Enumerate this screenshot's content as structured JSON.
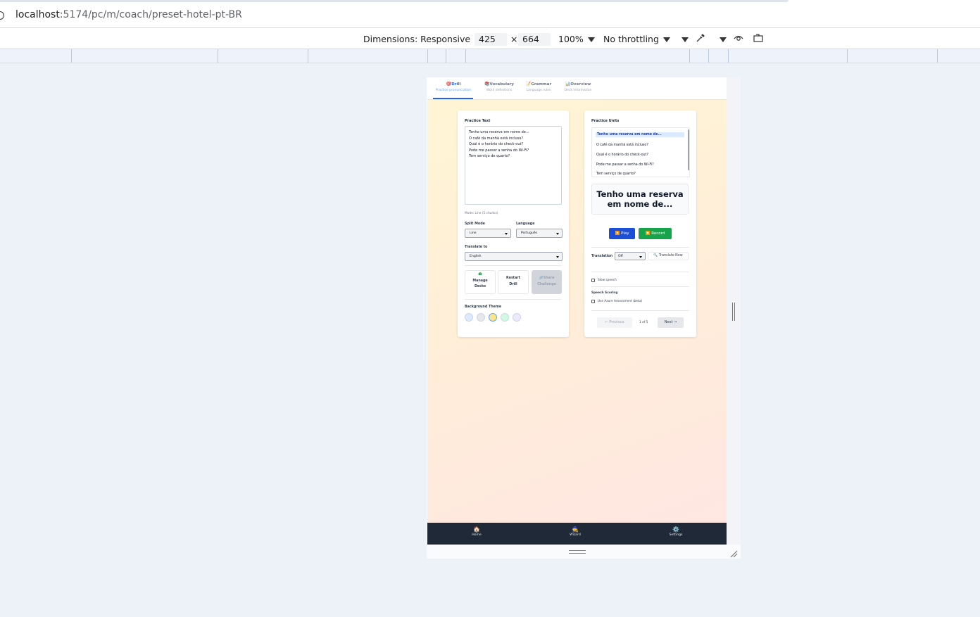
{
  "browser": {
    "url_host": "localhost",
    "url_path": ":5174/pc/m/coach/preset-hotel-pt-BR"
  },
  "devtools": {
    "dimensions_label": "Dimensions: Responsive",
    "width": "425",
    "times": "×",
    "height": "664",
    "zoom": "100%",
    "throttling": "No throttling"
  },
  "tabs": [
    {
      "icon": "🎯",
      "label": "Drill",
      "sub": "Practice pronunciation",
      "active": true
    },
    {
      "icon": "📚",
      "label": "Vocabulary",
      "sub": "Word definitions"
    },
    {
      "icon": "📝",
      "label": "Grammar",
      "sub": "Language rules"
    },
    {
      "icon": "📊",
      "label": "Overview",
      "sub": "Deck information"
    }
  ],
  "left_card": {
    "title": "Practice Text",
    "text_lines": [
      "Tenho uma reserva em nome de...",
      "O café da manhã está incluso?",
      "Qual é o horário do check-out?",
      "Pode me passar a senha do Wi-Fi?",
      "Tem serviço de quarto?"
    ],
    "mode_info": "Mode: Line (5 chunks)",
    "split_mode_label": "Split Mode",
    "split_mode_value": "Line",
    "language_label": "Language",
    "language_value": "Português",
    "translate_label": "Translate to",
    "translate_value": "English",
    "manage_decks_icon": "🦚",
    "manage_decks": [
      "Manage",
      "Decks"
    ],
    "restart_drill": [
      "Restart",
      "Drill"
    ],
    "share_challenge_icon": "🔗",
    "share_challenge": [
      "Share",
      "Challenge"
    ],
    "bg_theme_label": "Background Theme",
    "themes": [
      "#dbeafe",
      "#e5e7eb",
      "#fde68a",
      "#d1fae5",
      "#ede9fe"
    ],
    "active_theme": 2
  },
  "right_card": {
    "title": "Practice Units",
    "units": [
      "Tenho uma reserva em nome de...",
      "O café da manhã está incluso?",
      "Qual é o horário do check-out?",
      "Pode me passar a senha do Wi-Fi?",
      "Tem serviço de quarto?"
    ],
    "selected_index": 0,
    "current_line1": "Tenho uma reserva",
    "current_line2": "em nome de...",
    "play_label": "▶️ Play",
    "record_label": "⏺️ Record",
    "translation_label": "Translation",
    "translation_value": "Off",
    "translate_now": "🔍 Translate Now",
    "slow_speech": "Slow speech",
    "speech_scoring": "Speech Scoring",
    "azure_assessment": "Use Azure Assessment (beta)",
    "prev": "← Previous",
    "page": "1 of 5",
    "next": "Next →"
  },
  "bottom_nav": [
    {
      "icon": "🏠",
      "label": "Home"
    },
    {
      "icon": "🧙",
      "label": "Wizard"
    },
    {
      "icon": "⚙️",
      "label": "Settings"
    }
  ]
}
